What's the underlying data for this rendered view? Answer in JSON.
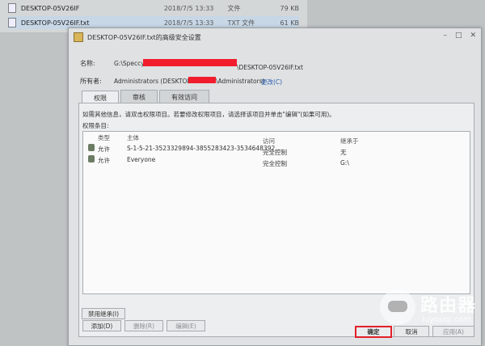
{
  "background_files": [
    {
      "name": "DESKTOP-05V26IF",
      "date": "2018/7/5 13:33",
      "type": "文件",
      "size": "79 KB",
      "selected": false
    },
    {
      "name": "DESKTOP-05V26IF.txt",
      "date": "2018/7/5 13:33",
      "type": "TXT 文件",
      "size": "61 KB",
      "selected": true
    }
  ],
  "dialog": {
    "title": "DESKTOP-05V26IF.txt的高级安全设置",
    "name_label": "名称:",
    "name_value_prefix": "G:\\Speccy\\",
    "name_value_suffix": "\\DESKTOP-05V26IF.txt",
    "owner_label": "所有者:",
    "owner_value_prefix": "Administrators (DESKTOP-",
    "owner_value_suffix": "\\Administrators)",
    "owner_change_link": "更改(C)",
    "tabs": [
      "权限",
      "审核",
      "有效访问"
    ],
    "description": "如需其他信息，请双击权限项目。若要修改权限项目，请选择该项目并单击\"编辑\"(如果可用)。",
    "entries_label": "权限条目:",
    "columns": {
      "type": "类型",
      "principal": "主体",
      "access": "访问",
      "inherited": "继承于"
    },
    "entries": [
      {
        "type": "允许",
        "principal": "S-1-5-21-3523329894-3855283423-3534648392...",
        "access": "完全控制",
        "inherited": "无"
      },
      {
        "type": "允许",
        "principal": "Everyone",
        "access": "完全控制",
        "inherited": "G:\\"
      }
    ],
    "buttons": {
      "add": "添加(D)",
      "remove": "删除(R)",
      "edit": "编辑(E)",
      "disable_inheritance": "禁用继承(I)",
      "ok": "确定",
      "cancel": "取消",
      "apply": "应用(A)"
    }
  },
  "watermark": {
    "title": "路由器",
    "url": "luyouqi.com"
  },
  "colors": {
    "redaction": "#f21d2c",
    "ok_highlight": "#e3202a",
    "link": "#2a5db0"
  }
}
